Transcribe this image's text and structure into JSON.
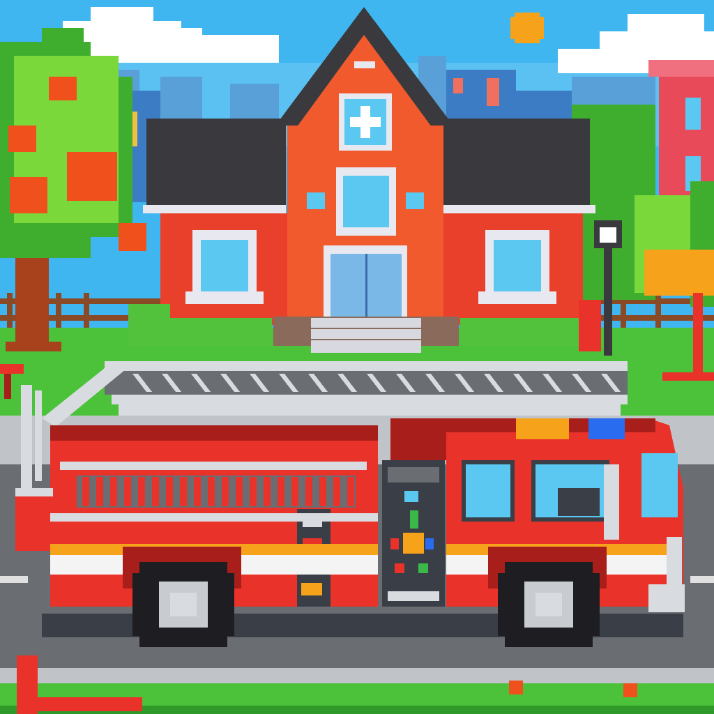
{
  "scene": {
    "description_kind": "pixel-art illustration",
    "colors": {
      "sky": "#3fb6f0",
      "sky_light": "#8fd8f8",
      "cloud": "#ffffff",
      "sun": "#f7a21b",
      "city_far": "#5aa0d8",
      "city_mid": "#3b7cc4",
      "tree_leaf": "#3fae2e",
      "tree_leaf_light": "#7ad83a",
      "tree_trunk": "#a8421c",
      "apple": "#f0501c",
      "fence": "#8a4a26",
      "grass": "#4cc23a",
      "grass_dark": "#2f9a2a",
      "brick": "#e8402a",
      "brick_dark": "#b82818",
      "brick_center": "#f05a2c",
      "roof": "#3a3a3e",
      "roof_trim": "#e8e8f0",
      "window_glass": "#5ac8f0",
      "door": "#7ab8e8",
      "steps": "#d8d8e0",
      "bush": "#52c23c",
      "road": "#6a6e72",
      "road_line": "#e0e0e0",
      "curb": "#c0c4c8",
      "truck_red": "#e8322a",
      "truck_red_dark": "#a81e1a",
      "truck_stripe_white": "#f4f4f4",
      "truck_stripe_orange": "#f7a21b",
      "ladder": "#d8dce0",
      "ladder_dark": "#6a6e72",
      "tire": "#1e1e22",
      "hubcap": "#c8ccd0",
      "light_orange": "#f7a21b",
      "light_blue": "#2a6cf0",
      "panel": "#3a3e46",
      "canopy": "#f7a21b",
      "hydrant": "#e8322a"
    },
    "icons": {
      "building_emblem": "white-cross-icon",
      "sun": "sun-icon"
    }
  }
}
